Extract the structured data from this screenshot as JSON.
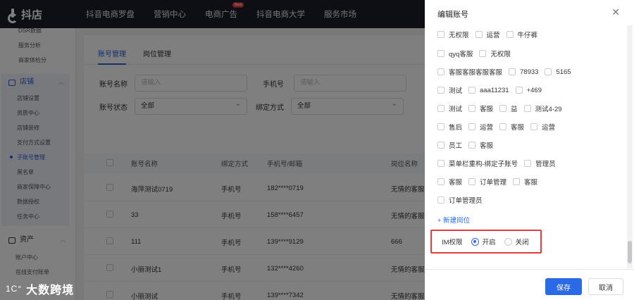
{
  "brand": {
    "name": "抖店"
  },
  "topnav": {
    "items": [
      "抖音电商罗盘",
      "营销中心",
      "电商广告",
      "抖音电商大学",
      "服务市场"
    ],
    "badge": "New"
  },
  "sidebar": {
    "top_items": [
      "DSR数据",
      "服务分析",
      "商家体检分"
    ],
    "group_store": {
      "label": "店铺",
      "items": [
        "店铺设置",
        "资质中心",
        "店铺装修",
        "支付方式设置",
        "子账号管理",
        "黑名单",
        "商家保障中心",
        "数据授权",
        "任务中心"
      ]
    },
    "group_assets": {
      "label": "资产",
      "items": [
        "账户中心",
        "在线支付账单"
      ]
    }
  },
  "main": {
    "tabs": [
      "账号管理",
      "岗位管理"
    ],
    "filters": {
      "account_name_label": "账号名称",
      "account_name_placeholder": "请输入",
      "phone_label": "手机号",
      "phone_placeholder": "请输入",
      "status_label": "账号状态",
      "status_value": "全部",
      "bind_label": "绑定方式",
      "bind_value": "全部"
    },
    "table": {
      "headers": [
        "账号名称",
        "绑定方式",
        "手机号/邮箱",
        "岗位名称"
      ],
      "rows": [
        [
          "海萍测试0719",
          "手机号",
          "182****0719",
          "无情的客服"
        ],
        [
          "33",
          "手机号",
          "158****6457",
          "无情的客服"
        ],
        [
          "111",
          "手机号",
          "139****9129",
          "666"
        ],
        [
          "小丽测试1",
          "手机号",
          "132****4260",
          "无情的客服"
        ],
        [
          "小丽测试",
          "手机号",
          "139****7342",
          "无情的客服"
        ]
      ]
    }
  },
  "drawer": {
    "title": "编辑账号",
    "role_rows": [
      [
        "无权限",
        "运营",
        "牛仔裤"
      ],
      [
        "qyq客服",
        "无权限"
      ],
      [
        "客服客服客服客服",
        "78933",
        "5165"
      ],
      [
        "测试",
        "aaa11231",
        "+469"
      ],
      [
        "测试",
        "客服",
        "益",
        "测试4-29"
      ],
      [
        "售后",
        "运营",
        "客服",
        "运营"
      ],
      [
        "员工",
        "客服"
      ],
      [
        "菜单栏重构-绑定子账号",
        "管理员"
      ],
      [
        "客服",
        "订单管理",
        "客服"
      ],
      [
        "订单管理员"
      ]
    ],
    "new_role": "+ 新建岗位",
    "im": {
      "label": "IM权限",
      "on": "开启",
      "off": "关闭",
      "selected": "on"
    },
    "save": "保存",
    "cancel": "取消"
  },
  "watermark": {
    "mark": "1C°",
    "text": "大数跨境"
  },
  "colors": {
    "accent": "#2b6ae6",
    "highlight": "#e23b3b",
    "topbar": "#1c1f2b"
  }
}
